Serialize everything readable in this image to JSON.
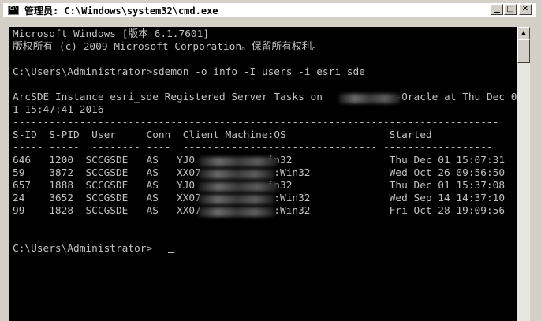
{
  "window": {
    "title": "管理员: C:\\Windows\\system32\\cmd.exe",
    "icon": "cmd-icon",
    "minimize_icon": "minimize-icon",
    "maximize_icon": "maximize-icon",
    "close_icon": "close-icon"
  },
  "console": {
    "lines": [
      "Microsoft Windows [版本 6.1.7601]",
      "版权所有 (c) 2009 Microsoft Corporation。保留所有权利。",
      "",
      "C:\\Users\\Administrator>sdemon -o info -I users -i esri_sde",
      "",
      "ArcSDE Instance esri_sde Registered Server Tasks on            -Oracle at Thu Dec 0",
      "1 15:47:41 2016",
      "--------------------------------------------------------------------------------",
      "S-ID  S-PID  User     Conn  Client Machine:OS                 Started",
      "----- -----  -------- ----  -------------------------------- ------------------",
      "646   1200  SCCGSDE   AS   YJ0            in32                Thu Dec 01 15:07:31",
      "59    3872  SCCGSDE   AS   XX07            :Win32             Wed Oct 26 09:56:50",
      "657   1888  SCCGSDE   AS   YJ0            in32                Thu Dec 01 15:37:08",
      "24    3652  SCCGSDE   AS   XX07            :Win32             Wed Sep 14 14:37:10",
      "99    1828  SCCGSDE   AS   XX07            :Win32             Fri Oct 28 19:09:56",
      "",
      "",
      "C:\\Users\\Administrator>"
    ]
  },
  "colors": {
    "console_bg": "#000000",
    "console_fg": "#c0c0c0",
    "chrome": "#d4d0c8"
  }
}
